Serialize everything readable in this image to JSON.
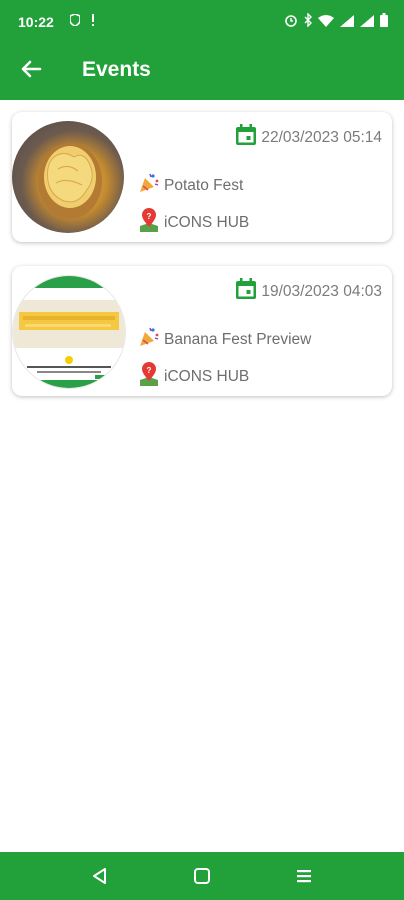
{
  "status_bar": {
    "time": "10:22",
    "left_icons": [
      "shield-icon",
      "alert-icon"
    ],
    "right_icons": [
      "alarm-icon",
      "bluetooth-icon",
      "wifi-icon",
      "signal-icon",
      "signal-icon",
      "battery-icon"
    ]
  },
  "app_bar": {
    "title": "Events"
  },
  "events": [
    {
      "date": "22/03/2023 05:14",
      "name": "Potato Fest",
      "location": "iCONS HUB"
    },
    {
      "date": "19/03/2023 04:03",
      "name": "Banana Fest Preview",
      "location": "iCONS HUB"
    }
  ],
  "colors": {
    "primary": "#22a03a",
    "text_muted": "#6e6e6e"
  },
  "nav_icons": [
    "back-triangle-icon",
    "home-square-icon",
    "menu-lines-icon"
  ]
}
